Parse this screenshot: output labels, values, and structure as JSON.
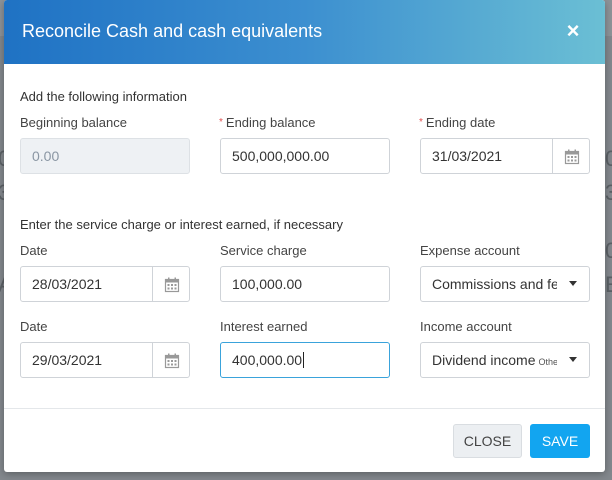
{
  "background": {
    "glyphs_left": [
      "0",
      "3",
      "A"
    ],
    "glyphs_right": [
      "0",
      "3",
      "0",
      "E"
    ]
  },
  "modal": {
    "title": "Reconcile Cash and cash equivalents",
    "close_icon": "×"
  },
  "section1": {
    "title": "Add the following information",
    "beginning_balance": {
      "label": "Beginning balance",
      "value": "0.00"
    },
    "ending_balance": {
      "required_mark": "*",
      "label": "Ending balance",
      "value": "500,000,000.00"
    },
    "ending_date": {
      "required_mark": "*",
      "label": "Ending date",
      "value": "31/03/2021"
    }
  },
  "section2": {
    "title": "Enter the service charge or interest earned, if necessary",
    "row1": {
      "date_label": "Date",
      "date_value": "28/03/2021",
      "service_charge_label": "Service charge",
      "service_charge_value": "100,000.00",
      "expense_account_label": "Expense account",
      "expense_account_value": "Commissions and fees"
    },
    "row2": {
      "date_label": "Date",
      "date_value": "29/03/2021",
      "interest_earned_label": "Interest earned",
      "interest_earned_value": "400,000.00",
      "income_account_label": "Income account",
      "income_account_value": "Dividend income",
      "income_account_tag": "Other in"
    }
  },
  "footer": {
    "close_label": "CLOSE",
    "save_label": "SAVE"
  },
  "colors": {
    "header_start": "#1f72c4",
    "header_end": "#6bbfd4",
    "primary": "#12a5f0",
    "required": "#e05050",
    "focus": "#3aa3db"
  },
  "icons": {
    "close": "close-icon",
    "calendar": "calendar-icon",
    "dropdown": "dropdown-arrow-icon"
  }
}
